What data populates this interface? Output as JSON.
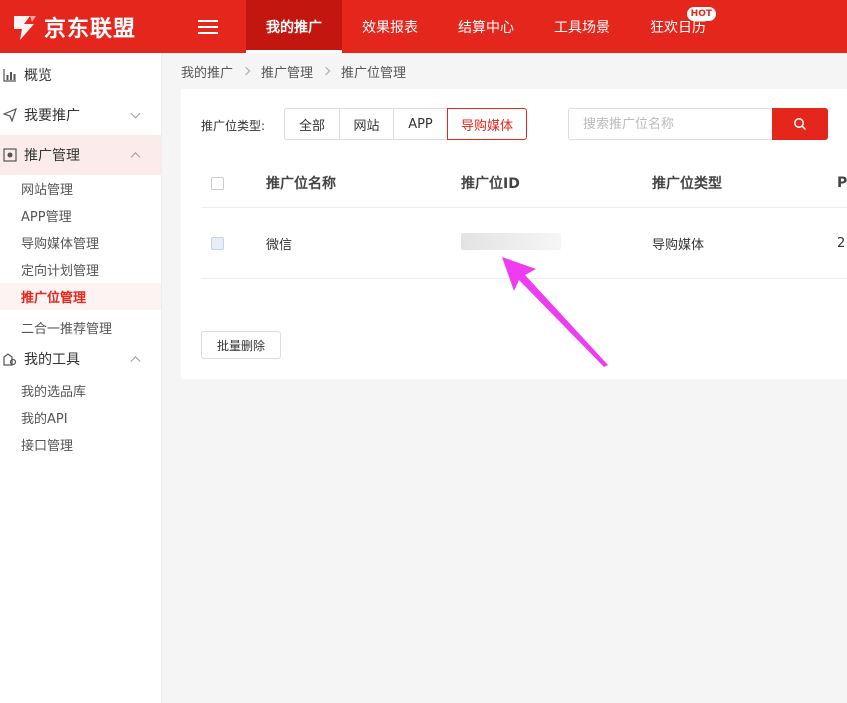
{
  "brand": {
    "name": "京东联盟",
    "color": "#e4261c"
  },
  "nav": {
    "items": [
      {
        "label": "我的推广",
        "active": true
      },
      {
        "label": "效果报表"
      },
      {
        "label": "结算中心"
      },
      {
        "label": "工具场景"
      },
      {
        "label": "狂欢日历",
        "badge": "HOT"
      }
    ]
  },
  "sidebar": {
    "overview": "概览",
    "promote": "我要推广",
    "manage": "推广管理",
    "manage_items": [
      "网站管理",
      "APP管理",
      "导购媒体管理",
      "定向计划管理",
      "推广位管理",
      "二合一推荐管理"
    ],
    "tools": "我的工具",
    "tools_items": [
      "我的选品库",
      "我的API",
      "接口管理"
    ]
  },
  "breadcrumb": [
    "我的推广",
    "推广管理",
    "推广位管理"
  ],
  "filter": {
    "label": "推广位类型:",
    "options": [
      "全部",
      "网站",
      "APP",
      "导购媒体"
    ],
    "selected": "导购媒体"
  },
  "search": {
    "placeholder": "搜索推广位名称"
  },
  "table": {
    "headers": [
      "推广位名称",
      "推广位ID",
      "推广位类型",
      "P"
    ],
    "rows": [
      {
        "name": "微信",
        "type": "导购媒体",
        "extra": "2"
      }
    ]
  },
  "batch_delete": "批量删除",
  "annotation": {
    "color": "#ee3df0"
  }
}
